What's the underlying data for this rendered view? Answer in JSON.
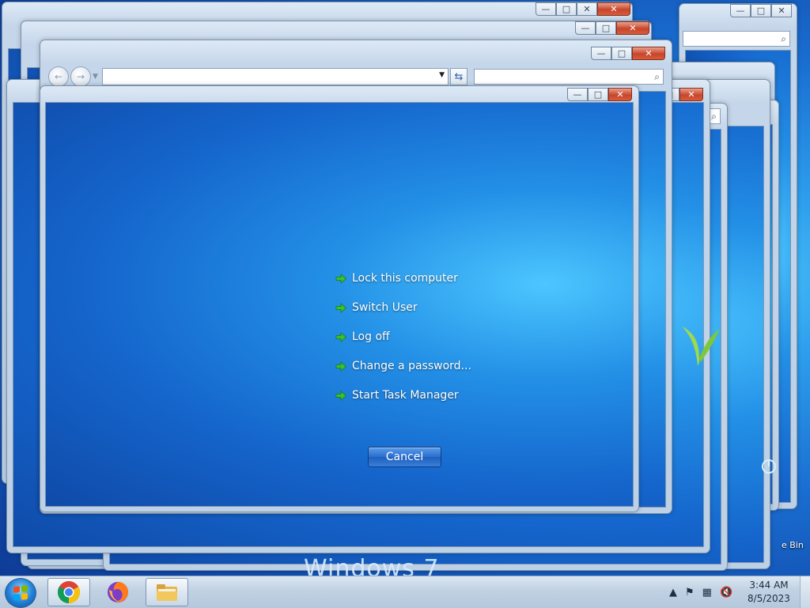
{
  "security_menu": {
    "items": [
      {
        "label": "Lock this computer"
      },
      {
        "label": "Switch User"
      },
      {
        "label": "Log off"
      },
      {
        "label": "Change a password..."
      },
      {
        "label": "Start Task Manager"
      }
    ],
    "cancel_label": "Cancel"
  },
  "desktop": {
    "recycle_bin_label_fragment": "e Bin",
    "watermark": "Windows 7"
  },
  "caption_buttons": {
    "minimize": "—",
    "maximize": "□",
    "close": "✕"
  },
  "taskbar": {
    "pinned": [
      {
        "name": "chrome-icon"
      },
      {
        "name": "firefox-icon"
      },
      {
        "name": "folder-icon"
      }
    ],
    "clock": {
      "time": "3:44 AM",
      "date": "8/5/2023"
    }
  },
  "colors": {
    "arrow_green": "#34c22a",
    "accent_blue": "#1f64c4"
  }
}
